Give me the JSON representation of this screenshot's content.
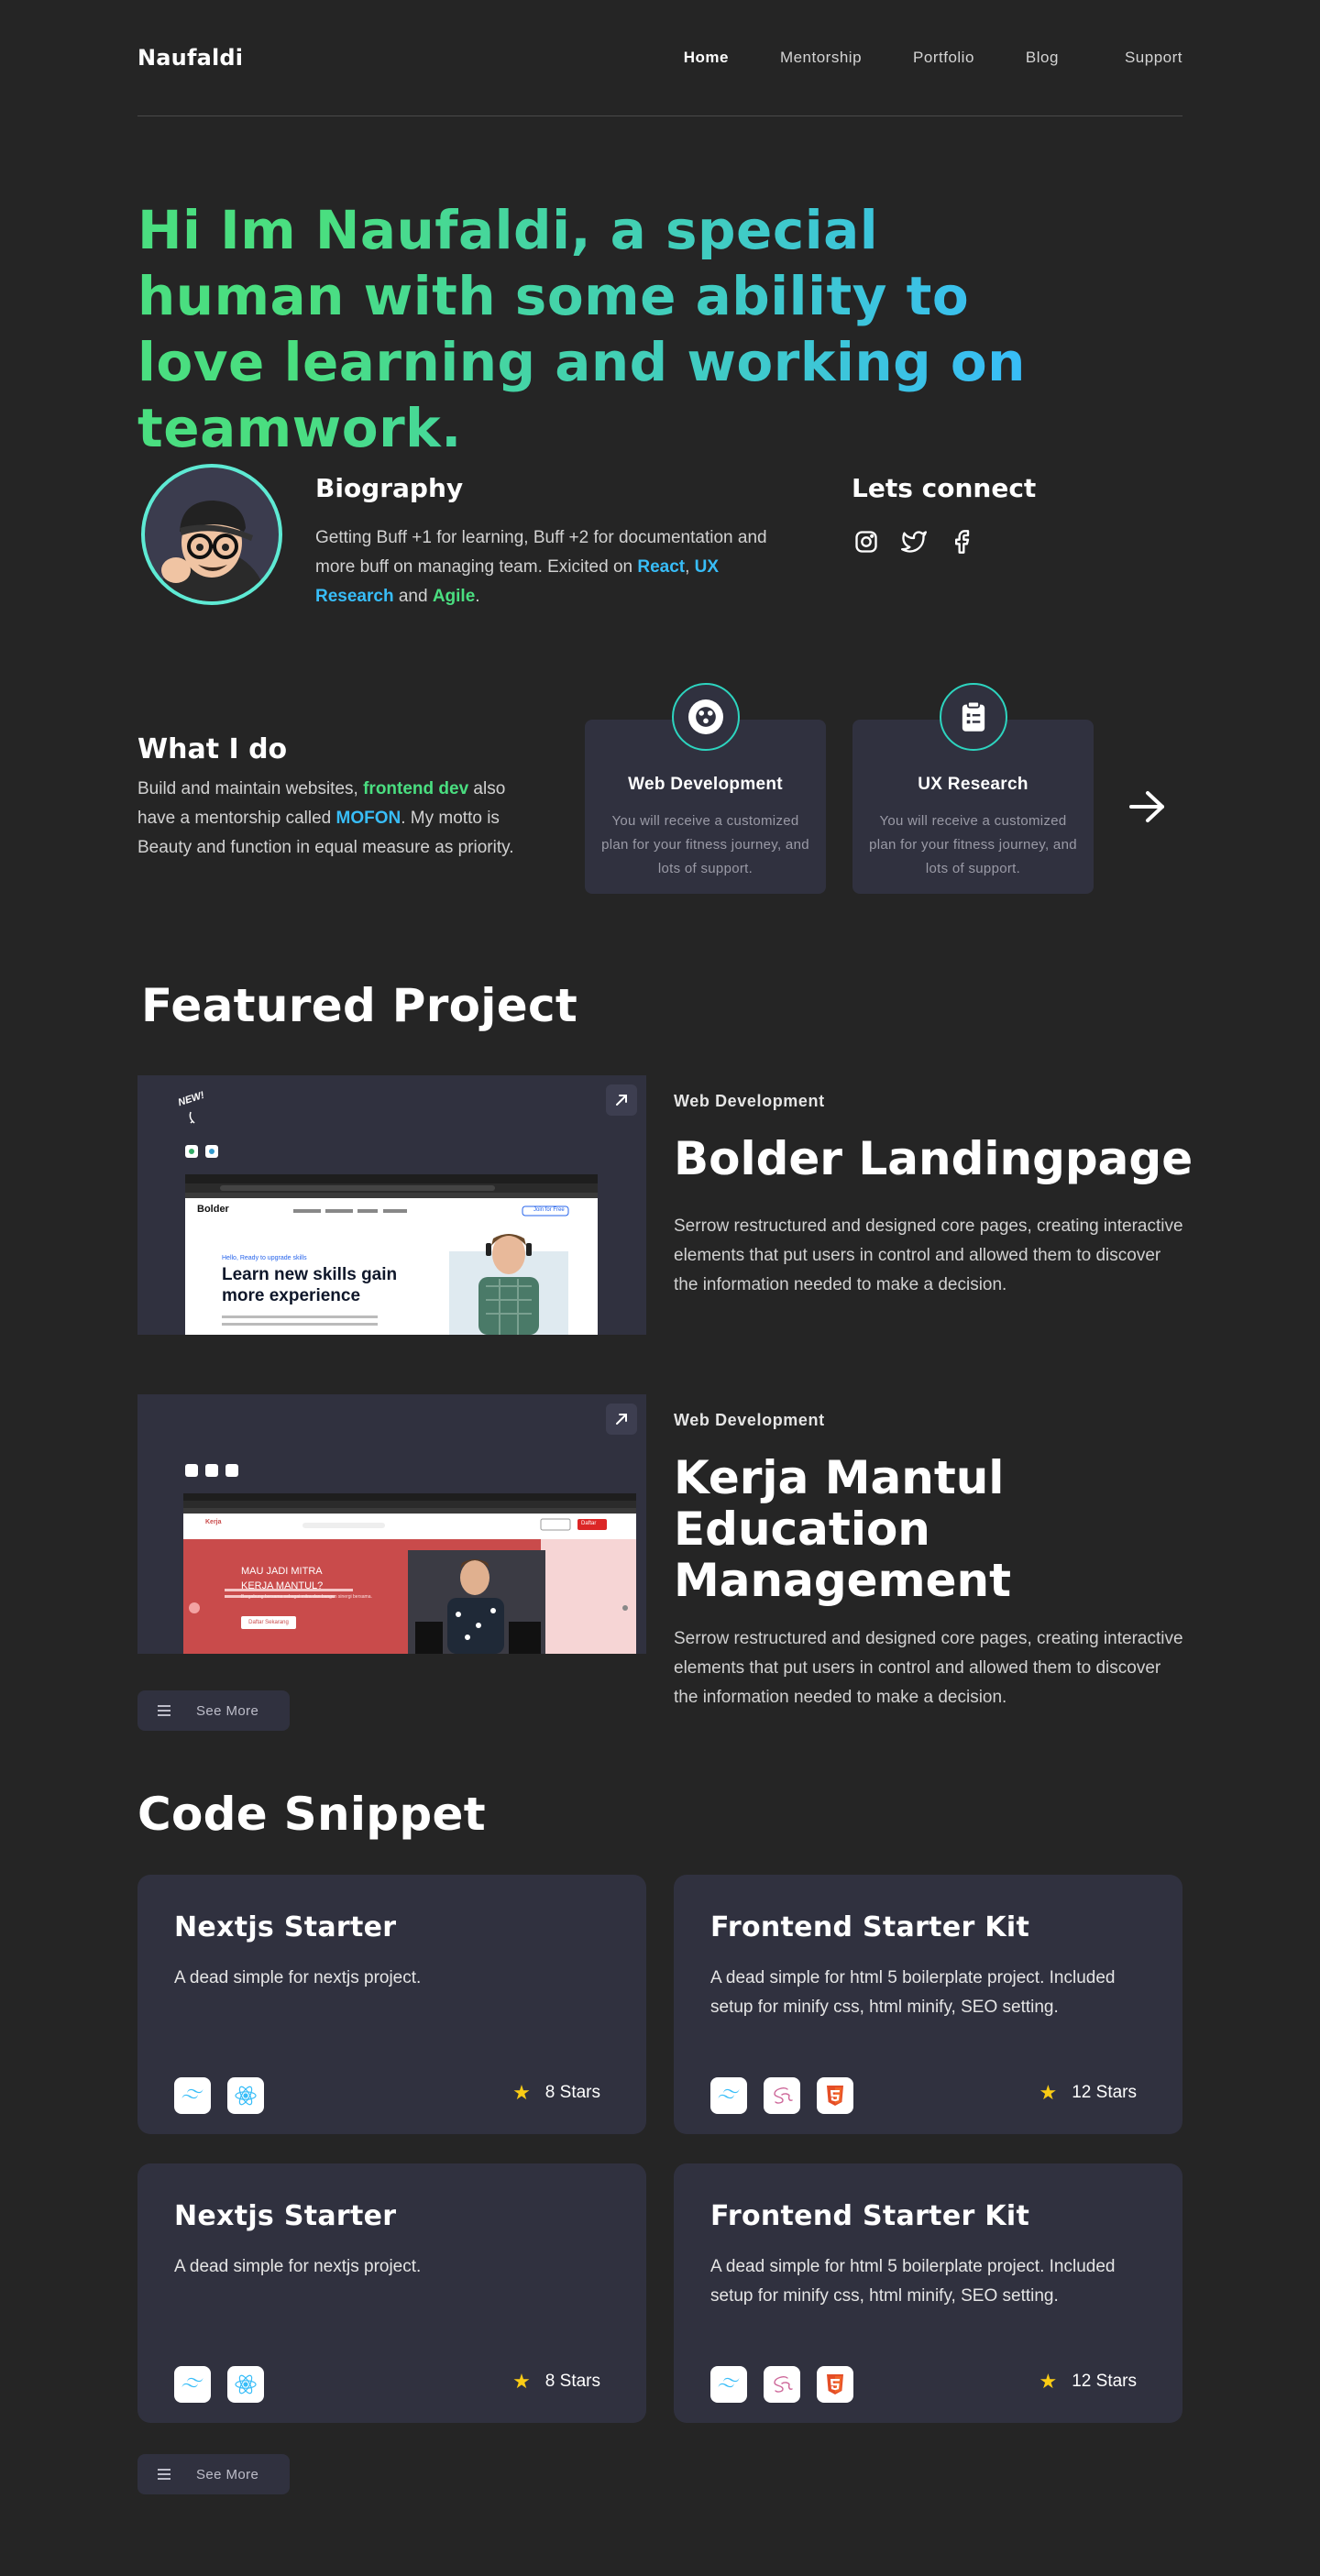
{
  "nav": {
    "brand": "Naufaldi",
    "links": [
      "Home",
      "Mentorship",
      "Portfolio",
      "Blog",
      "Support"
    ]
  },
  "hero": {
    "headline": "Hi Im Naufaldi, a special human with some ability to love learning and working on teamwork."
  },
  "biography": {
    "title": "Biography",
    "text_prefix": "Getting Buff +1 for learning, Buff +2 for documentation and more buff on managing team. Exicited on ",
    "hl1": "React",
    "sep1": ", ",
    "hl2": "UX Research",
    "sep2": " and ",
    "hl3": "Agile",
    "end": "."
  },
  "connect": {
    "title": "Lets connect",
    "icons": [
      "instagram-icon",
      "twitter-icon",
      "facebook-icon"
    ]
  },
  "what_i_do": {
    "title": "What I do",
    "t1": "Build and maintain websites, ",
    "hl1": "frontend dev",
    "t2": " also have a mentorship called ",
    "hl2": "MOFON",
    "t3": ". My motto is Beauty and function in equal measure as priority.",
    "services": [
      {
        "title": "Web Development",
        "desc": "You will receive a customized plan for your fitness journey, and lots of support.",
        "icon": "web-icon"
      },
      {
        "title": "UX Research",
        "desc": "You will receive a customized plan for your fitness journey, and lots of support.",
        "icon": "clipboard-icon"
      }
    ]
  },
  "featured": {
    "title": "Featured Project",
    "projects": [
      {
        "category": "Web Development",
        "name": "Bolder Landingpage",
        "desc": "Serrow restructured and designed core pages, creating interactive elements that put users in control and allowed them to discover the information needed to make a decision.",
        "shot": {
          "badge": "NEW!",
          "logo": "Bolder",
          "kicker": "Hello, Ready to upgrade skills",
          "headline": "Learn new skills gain more experience",
          "sub": "Build new skills and experience with courses and certificates online from professional world-class industry companies & institutions.",
          "cta": "Join for Free"
        }
      },
      {
        "category": "Web Development",
        "name": "Kerja Mantul Education Management",
        "desc": "Serrow restructured and designed core pages, creating interactive elements that put users in control and allowed them to discover the information needed to make a decision.",
        "shot": {
          "logo": "Kerja",
          "headline": "MAU JADI MITRA KERJA MANTUL?",
          "sub": "Bergabung bersama sebagai mitra dan bangun sinergi bersama.",
          "cta": "Daftar Sekarang",
          "nav_cta": "Daftar"
        }
      }
    ],
    "see_more": "See More"
  },
  "code": {
    "title": "Code Snippet",
    "snippets": [
      {
        "title": "Nextjs Starter",
        "desc": "A dead simple for nextjs project.",
        "stars": "8 Stars",
        "tech": [
          "tailwind-icon",
          "react-icon"
        ]
      },
      {
        "title": "Frontend Starter Kit",
        "desc": "A dead simple for html 5 boilerplate project. Included setup for minify css, html minify, SEO setting.",
        "stars": "12 Stars",
        "tech": [
          "tailwind-icon",
          "sass-icon",
          "html5-icon"
        ]
      },
      {
        "title": "Nextjs Starter",
        "desc": "A dead simple for nextjs project.",
        "stars": "8 Stars",
        "tech": [
          "tailwind-icon",
          "react-icon"
        ]
      },
      {
        "title": "Frontend Starter Kit",
        "desc": "A dead simple for html 5 boilerplate project. Included setup for minify css, html minify, SEO setting.",
        "stars": "12 Stars",
        "tech": [
          "tailwind-icon",
          "sass-icon",
          "html5-icon"
        ]
      }
    ],
    "see_more": "See More"
  },
  "colors": {
    "bg": "#252525",
    "card": "#30313f",
    "green": "#4ade80",
    "blue": "#38bdf8",
    "teal": "#2dd4bf",
    "star": "#facc15"
  }
}
